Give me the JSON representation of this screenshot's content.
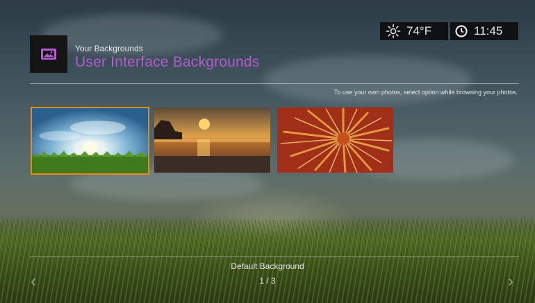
{
  "header": {
    "subtitle": "Your Backgrounds",
    "title": "User Interface Backgrounds",
    "icon": "image-icon"
  },
  "status": {
    "weather_icon": "sun-icon",
    "temperature": "74°F",
    "clock_icon": "clock-icon",
    "time": "11:45"
  },
  "hint": "To use your own photos, select option while browsing your photos.",
  "thumbnails": [
    {
      "name": "sunrise-over-grass",
      "selected": true
    },
    {
      "name": "beach-sunset",
      "selected": false
    },
    {
      "name": "red-sea-anemone",
      "selected": false
    }
  ],
  "footer": {
    "caption": "Default Background",
    "page_indicator": "1 / 3",
    "left_arrow_icon": "chevron-left-icon",
    "right_arrow_icon": "chevron-right-icon"
  },
  "colors": {
    "accent_title": "#b35ccf",
    "selection_border": "#e58a1b"
  }
}
